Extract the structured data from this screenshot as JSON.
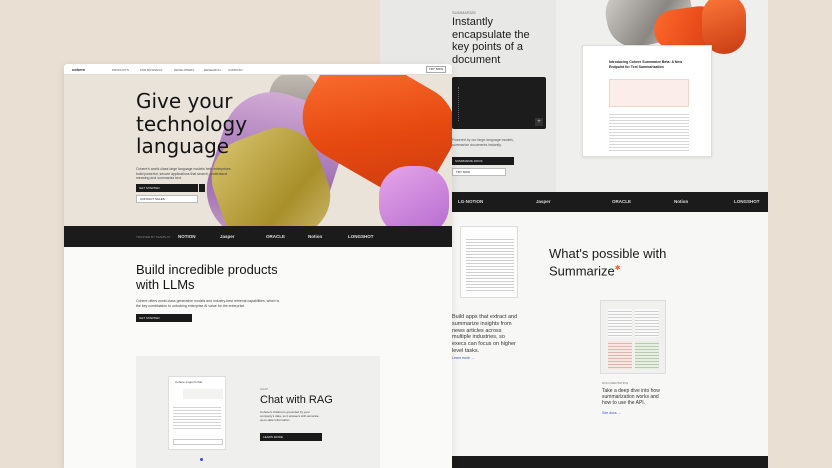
{
  "back": {
    "kicker": "SUMMARIZE",
    "heading": "Instantly encapsulate the key points of a document",
    "paragraph": "Powered by our large language models, summarize documents instantly.",
    "btn_primary": "SUMMARIZE DOCS",
    "btn_secondary": "TRY NOW",
    "article_title": "Introducing Cohere Summarize Beta: A New Endpoint for Text Summarization",
    "logos": [
      "LG-NOTION",
      "Jasper",
      "ORACLE",
      "Notion",
      "LONGSHOT"
    ],
    "whats_possible": "What's possible with Summarize",
    "bm_paragraph": "Build apps that extract and summarize insights from news articles across multiple industries, so execs can focus on higher level tasks.",
    "bm_link": "Learn more →",
    "deep_kicker": "DOCUMENTATION",
    "deep_paragraph": "Take a deep dive into how summarization works and how to use the API.",
    "deep_link": "See docs →"
  },
  "front": {
    "nav": {
      "logo": "cohere",
      "items": [
        "PRODUCTS",
        "FOR BUSINESS",
        "DEVELOPERS",
        "RESEARCH",
        "COMPANY"
      ],
      "cta": "TRY NOW"
    },
    "hero": {
      "heading": "Give your technology language",
      "paragraph": "Cohere's world-class large language models help enterprises build powerful, secure applications that search, understand meaning and summarize text.",
      "btn_primary": "GET STARTED",
      "btn_secondary": "CONTACT SALES"
    },
    "strip": {
      "label": "TRUSTED BY TEAMS AT",
      "logos": [
        "NOTION",
        "Jasper",
        "ORACLE",
        "Notion",
        "LONGSHOT"
      ]
    },
    "build": {
      "heading": "Build incredible products with LLMs",
      "paragraph": "Cohere offers world-class generative models and industry-best retrieval capabilities, which is the key combination to unlocking enterprise AI value for the enterprise.",
      "button": "GET STARTED"
    },
    "rag": {
      "chat_header": "Cohere support chat",
      "kicker": "CHAT",
      "heading": "Chat with RAG",
      "paragraph": "Cohere's chatbot is grounded by your company's data, so it answers with accurate, up-to-date information.",
      "button": "LEARN MORE"
    }
  }
}
